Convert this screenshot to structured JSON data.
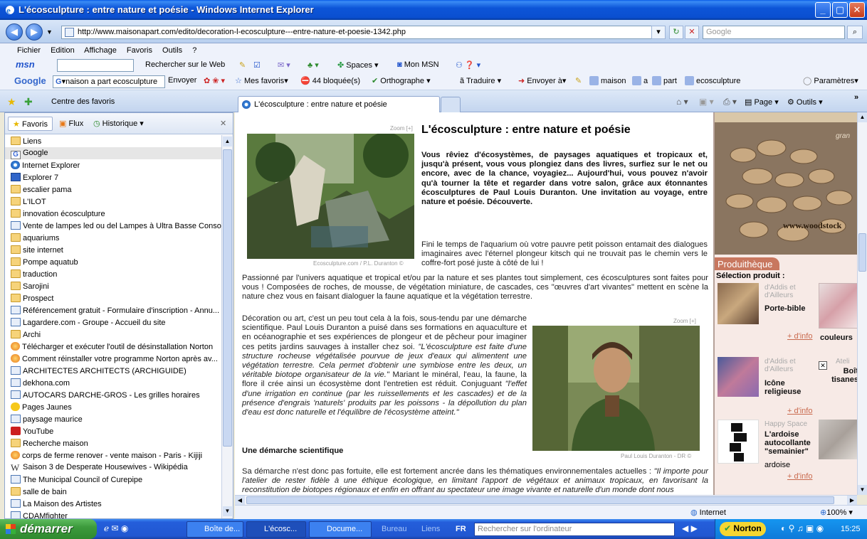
{
  "window": {
    "title": "L'écosculpture : entre nature et poésie - Windows Internet Explorer"
  },
  "address": {
    "url": "http://www.maisonapart.com/edito/decoration-l-ecosculpture---entre-nature-et-poesie-1342.php",
    "search_placeholder": "Google"
  },
  "menu": [
    "Fichier",
    "Edition",
    "Affichage",
    "Favoris",
    "Outils",
    "?"
  ],
  "msnbar": {
    "logo": "msn",
    "search_label": "Rechercher sur le Web",
    "spaces": "Spaces",
    "mon_msn": "Mon MSN"
  },
  "googlebar": {
    "logo": "Google",
    "query": "naison a part ecosculpture",
    "envoyer": "Envoyer",
    "mes_favoris": "Mes favoris",
    "bloquees": "44 bloquée(s)",
    "orthographe": "Orthographe",
    "traduire": "Traduire",
    "envoyer_a": "Envoyer à",
    "terms": [
      "maison",
      "a",
      "part",
      "ecosculpture"
    ],
    "parametres": "Paramètres"
  },
  "favbar": {
    "centre": "Centre des favoris",
    "tab_title": "L'écosculpture : entre nature et poésie",
    "page_btn": "Page",
    "outils_btn": "Outils"
  },
  "favpane": {
    "tabs": [
      "Favoris",
      "Flux",
      "Historique"
    ],
    "items": [
      {
        "label": "Liens",
        "icon": "folder"
      },
      {
        "label": "Google",
        "icon": "google"
      },
      {
        "label": "Internet Explorer",
        "icon": "ie"
      },
      {
        "label": "Explorer 7",
        "icon": "blue"
      },
      {
        "label": "escalier pama",
        "icon": "folder"
      },
      {
        "label": "L'ILOT",
        "icon": "folder"
      },
      {
        "label": "innovation écosculpture",
        "icon": "folder"
      },
      {
        "label": "Vente de lampes led ou del Lampes à Ultra Basse Conso...",
        "icon": "page"
      },
      {
        "label": "aquariums",
        "icon": "folder"
      },
      {
        "label": "site internet",
        "icon": "folder"
      },
      {
        "label": "Pompe aquatub",
        "icon": "folder"
      },
      {
        "label": "traduction",
        "icon": "folder"
      },
      {
        "label": "Sarojini",
        "icon": "folder"
      },
      {
        "label": "Prospect",
        "icon": "folder"
      },
      {
        "label": "Référencement gratuit - Formulaire d'inscription - Annu...",
        "icon": "page"
      },
      {
        "label": "Lagardere.com - Groupe - Accueil du site",
        "icon": "page"
      },
      {
        "label": "Archi",
        "icon": "folder"
      },
      {
        "label": "Télécharger et exécuter l'outil de désinstallation Norton",
        "icon": "orange"
      },
      {
        "label": "Comment réinstaller votre programme Norton après av...",
        "icon": "orange"
      },
      {
        "label": "ARCHITECTES ARCHITECTS (ARCHIGUIDE)",
        "icon": "page"
      },
      {
        "label": "dekhona.com",
        "icon": "page"
      },
      {
        "label": "AUTOCARS DARCHE-GROS - Les grilles horaires",
        "icon": "page"
      },
      {
        "label": "Pages Jaunes",
        "icon": "pj"
      },
      {
        "label": "paysage maurice",
        "icon": "page"
      },
      {
        "label": "YouTube",
        "icon": "yt"
      },
      {
        "label": "Recherche maison",
        "icon": "folder"
      },
      {
        "label": "corps de ferme renover - vente maison - Paris - Kijiji",
        "icon": "orange"
      },
      {
        "label": "Saison 3 de Desperate Housewives - Wikipédia",
        "icon": "w"
      },
      {
        "label": "The Municipal Council of Curepipe",
        "icon": "page"
      },
      {
        "label": "salle de bain",
        "icon": "folder"
      },
      {
        "label": "La Maison des Artistes",
        "icon": "page"
      },
      {
        "label": "CDAMfighter",
        "icon": "page"
      }
    ]
  },
  "article": {
    "title": "L'écosculpture : entre nature et poésie",
    "zoom1": "Zoom [+]",
    "zoom2": "Zoom [+]",
    "caption1": "Ecosculpture.com / P.L. Duranton ©",
    "caption2": "Paul Louis Duranton - DR ©",
    "intro": "Vous rêviez d'écosystèmes, de paysages aquatiques et tropicaux et, jusqu'à présent, vous vous plongiez dans des livres, surfiez sur le net ou encore, avec de la chance, voyagiez... Aujourd'hui, vous pouvez n'avoir qu'à tourner la tête et regarder dans votre salon, grâce aux étonnantes écosculptures de Paul Louis Duranton. Une invitation au voyage, entre nature et poésie. Découverte.",
    "p1": "Fini le temps de l'aquarium où votre pauvre petit poisson entamait des dialogues imaginaires avec l'éternel plongeur kitsch qui ne trouvait pas le chemin vers le coffre-fort posé juste à côté de lui !",
    "p2": "Passionné par l'univers aquatique et tropical et/ou par la nature et ses plantes tout simplement, ces écosculptures sont faites pour vous ! Composées de roches, de mousse, de végétation miniature, de cascades, ces \"œuvres d'art vivantes\" mettent en scène la nature chez vous en faisant dialoguer la faune aquatique et la végétation terrestre.",
    "p3a": "Décoration ou art, c'est un peu tout cela à la fois, sous-tendu par une démarche scientifique. Paul Louis Duranton a puisé dans ses formations en aquaculture et en océanographie et ses expériences de plongeur et de pêcheur pour imaginer ces petits jardins sauvages à installer chez soi. ",
    "p3b": "\"L'écosculpture est faite d'une structure rocheuse végétalisée pourvue de jeux d'eaux qui alimentent une végétation terrestre. Cela permet d'obtenir une symbiose entre les deux, un véritable biotope organisateur de la vie.\"",
    "p3c": " Mariant le minéral, l'eau, la faune, la flore il crée ainsi un écosystème dont l'entretien est réduit. Conjuguant ",
    "p3d": "\"l'effet d'une irrigation en continue (par les ruissellements et les cascades) et de la présence d'engrais 'naturels' produits par les poissons - la dépollution du plan d'eau est donc naturelle et l'équilibre de l'écosystème atteint.\"",
    "subtitle": "Une démarche scientifique",
    "p4a": "Sa démarche n'est donc pas fortuite, elle est fortement ancrée dans les thématiques environnementales actuelles : ",
    "p4b": "\"Il importe pour l'atelier de rester fidèle à une éthique écologique, en limitant l'apport de végétaux et animaux tropicaux, en favorisant la reconstitution de biotopes régionaux et enfin en offrant au spectateur une image vivante et naturelle d'un monde dont nous"
  },
  "sidebar": {
    "ad_url": "www.woodstock",
    "ad_top": "gran",
    "prod_title": "Produithèque",
    "selection": "Sélection produit :",
    "products": [
      {
        "brand": "d'Addis et d'Ailleurs",
        "name": "Porte-bible",
        "link": "+ d'info"
      },
      {
        "brand": "",
        "name": "couleurs",
        "link": ""
      },
      {
        "brand": "d'Addis et d'Ailleurs",
        "name": "Icône religieuse",
        "link": "+ d'info"
      },
      {
        "brand": "Ateli",
        "name": "Boît tisanes",
        "link": ""
      },
      {
        "brand": "Happy Space",
        "name": "L'ardoise autocollante \"semainier\"",
        "name2": "ardoise",
        "link": "+ d'info"
      }
    ]
  },
  "status": {
    "zone": "Internet",
    "zoom": "100%"
  },
  "taskbar": {
    "start": "démarrer",
    "tasks": [
      "Boîte de...",
      "L'écosc...",
      "Docume..."
    ],
    "bureau": "Bureau",
    "liens": "Liens",
    "lang": "FR",
    "search_placeholder": "Rechercher sur l'ordinateur",
    "norton": "Norton",
    "clock": "15:25"
  },
  "colors": {
    "accent": "#0a4fd0",
    "produit": "#c8775f"
  }
}
